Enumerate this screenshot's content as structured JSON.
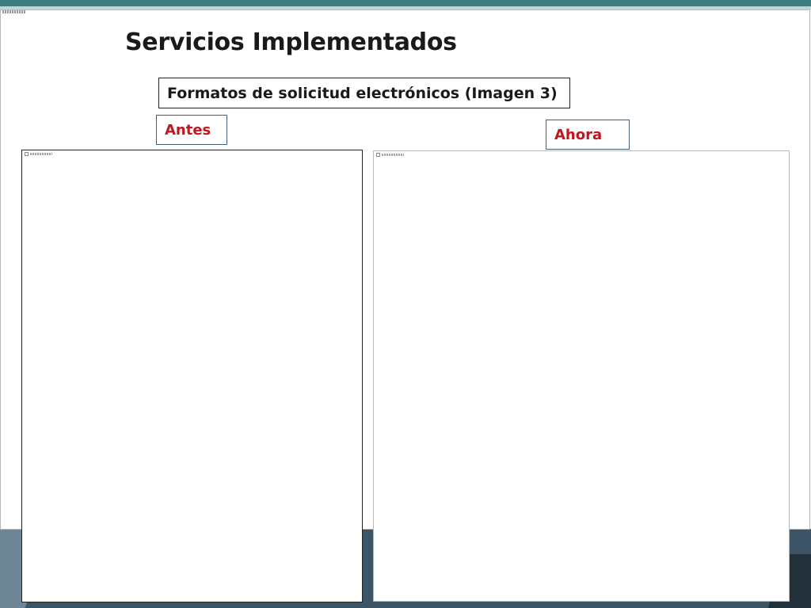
{
  "slide": {
    "title": "Servicios Implementados",
    "subtitle": "Formatos de solicitud electrónicos (Imagen 3)",
    "before_label": "Antes",
    "after_label": "Ahora"
  },
  "colors": {
    "top_band": "#3d7c80",
    "bottom_band": "#3c5566",
    "label_text": "#c0161e",
    "label_border": "#42607a"
  },
  "icons": {
    "broken_image": "broken-image-icon"
  }
}
